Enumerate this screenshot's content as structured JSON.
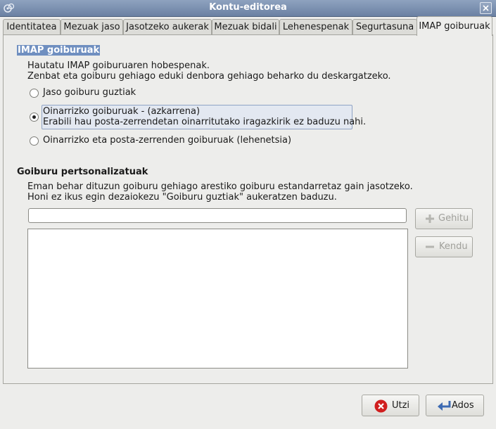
{
  "window": {
    "title": "Kontu-editorea"
  },
  "tabs": [
    {
      "label": "Identitatea"
    },
    {
      "label": "Mezuak jaso"
    },
    {
      "label": "Jasotzeko aukerak"
    },
    {
      "label": "Mezuak bidali"
    },
    {
      "label": "Lehenespenak"
    },
    {
      "label": "Segurtasuna"
    },
    {
      "label": "IMAP goiburuak",
      "active": true
    }
  ],
  "imap": {
    "title": "IMAP goiburuak",
    "desc_line1": "Hautatu IMAP goiburuaren hobespenak.",
    "desc_line2": "Zenbat eta goiburu gehiago eduki denbora gehiago beharko du deskargatzeko.",
    "options": [
      {
        "label": "Jaso goiburu guztiak",
        "selected": false
      },
      {
        "label": "Oinarrizko goiburuak - (azkarrena)",
        "sublabel": "Erabili hau posta-zerrendetan oinarritutako iragazkirik ez baduzu nahi.",
        "selected": true
      },
      {
        "label": "Oinarrizko eta posta-zerrenden goiburuak (lehenetsia)",
        "selected": false
      }
    ]
  },
  "custom": {
    "title": "Goiburu pertsonalizatuak",
    "desc_line1": "Eman behar dituzun goiburu gehiago arestiko goiburu estandarretaz gain jasotzeko.",
    "desc_line2": "Honi ez ikus egin dezaiokezu \"Goiburu guztiak\" aukeratzen baduzu.",
    "input_value": "",
    "add_label": "Gehitu",
    "remove_label": "Kendu",
    "headers": []
  },
  "footer": {
    "cancel_label": "Utzi",
    "ok_label": "Ados"
  },
  "colors": {
    "titlebar": "#7b8fb0",
    "selection": "#6f8fc0",
    "cancel_icon": "#d01e1e",
    "ok_icon": "#3d6bb3"
  }
}
